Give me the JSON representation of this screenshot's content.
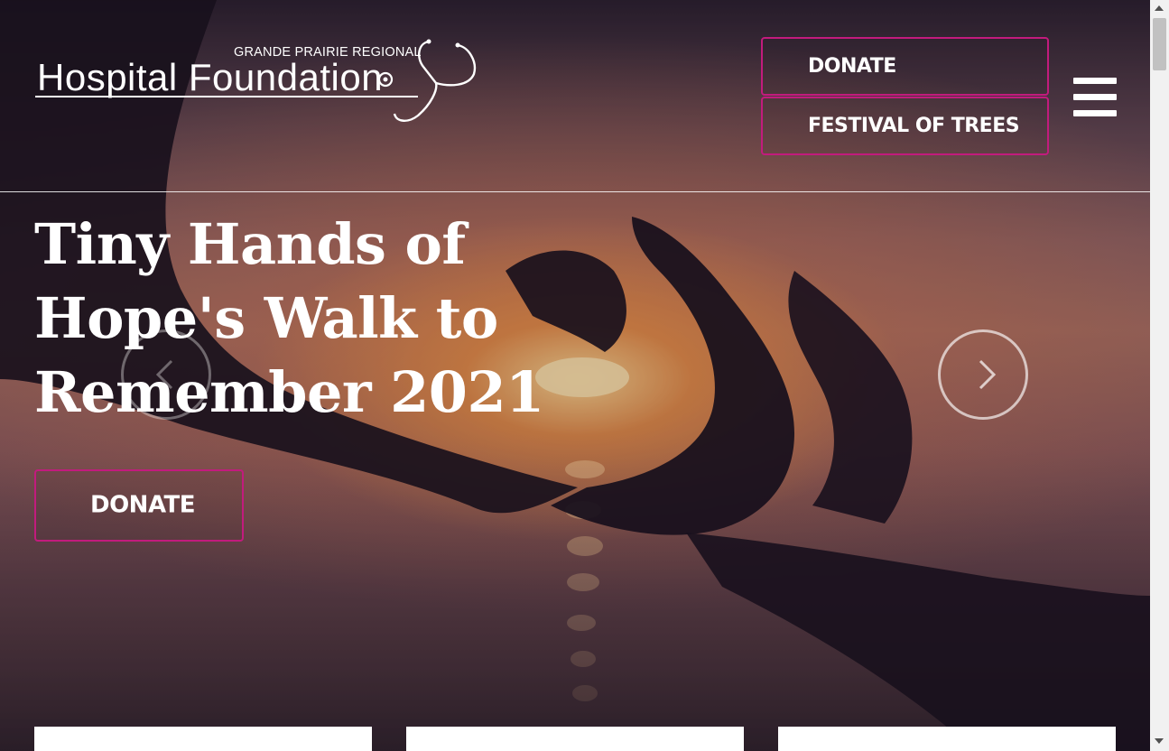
{
  "header": {
    "logo": {
      "small_text": "GRANDE PRAIRIE REGIONAL",
      "big_text": "Hospital Foundation"
    },
    "buttons": {
      "donate": "DONATE",
      "festival": "FESTIVAL OF TREES"
    },
    "menu_icon": "hamburger-menu-icon"
  },
  "hero": {
    "title": "Tiny Hands of Hope's Walk to Remember 2021",
    "donate_label": "DONATE",
    "prev_icon": "chevron-left-icon",
    "next_icon": "chevron-right-icon"
  },
  "colors": {
    "accent": "#c21b7d",
    "text": "#ffffff"
  }
}
